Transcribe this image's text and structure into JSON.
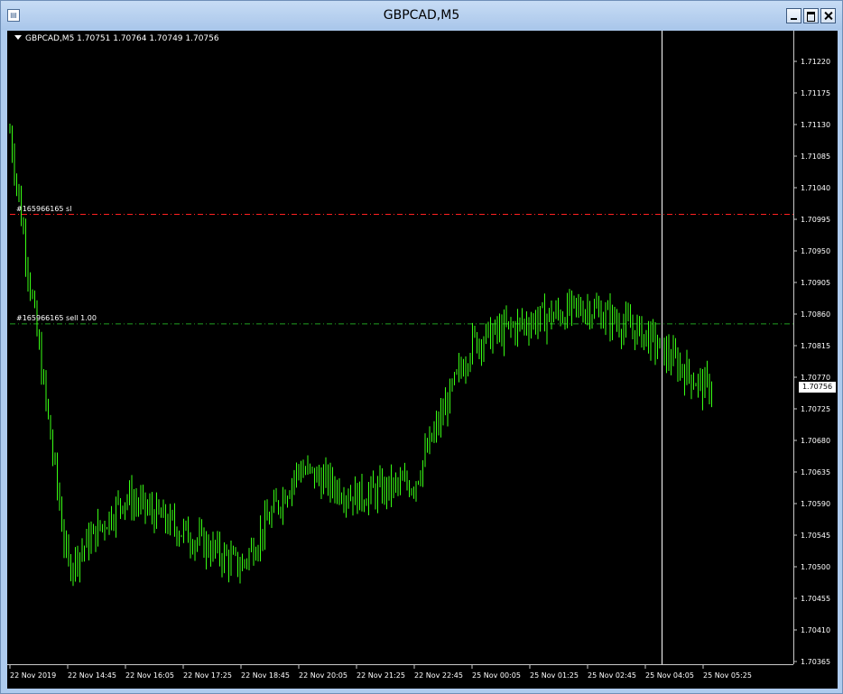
{
  "window": {
    "title": "GBPCAD,M5",
    "icon": "chart-window-icon",
    "buttons": [
      "minimize",
      "maximize",
      "close"
    ]
  },
  "colors": {
    "background": "#000000",
    "candles": "#39ff14",
    "grid_axis": "#c8c8c8",
    "sl_line": "#ff2020",
    "order_line": "#22a022",
    "crosshair": "#ffffff",
    "window_frame": "#aecbee"
  },
  "chart": {
    "symbol_info": "GBPCAD,M5  1.70751 1.70764 1.70749 1.70756",
    "current_price_label": "1.70756",
    "sl_label": "#165966165 sl",
    "order_label": "#165966165 sell 1.00",
    "price_ticks": [
      "1.71220",
      "1.71175",
      "1.71130",
      "1.71085",
      "1.71040",
      "1.70995",
      "1.70950",
      "1.70905",
      "1.70860",
      "1.70815",
      "1.70770",
      "1.70725",
      "1.70680",
      "1.70635",
      "1.70590",
      "1.70545",
      "1.70500",
      "1.70455",
      "1.70410",
      "1.70365"
    ],
    "time_ticks": [
      "22 Nov 2019",
      "22 Nov 14:45",
      "22 Nov 16:05",
      "22 Nov 17:25",
      "22 Nov 18:45",
      "22 Nov 20:05",
      "22 Nov 21:25",
      "22 Nov 22:45",
      "25 Nov 00:05",
      "25 Nov 01:25",
      "25 Nov 02:45",
      "25 Nov 04:05",
      "25 Nov 05:25"
    ]
  },
  "chart_data": {
    "type": "candlestick",
    "ylim": [
      1.7036,
      1.7126
    ],
    "price_levels": {
      "sl": 1.71002,
      "order": 1.70846,
      "current": 1.70756
    },
    "points": [
      {
        "x": "22 Nov 2019",
        "y": 1.7112
      },
      {
        "x": "22 Nov 14:45",
        "y": 1.705
      },
      {
        "x": "22 Nov 16:05",
        "y": 1.706
      },
      {
        "x": "22 Nov 17:25",
        "y": 1.7055
      },
      {
        "x": "22 Nov 18:45",
        "y": 1.705
      },
      {
        "x": "22 Nov 20:05",
        "y": 1.7064
      },
      {
        "x": "22 Nov 21:25",
        "y": 1.706
      },
      {
        "x": "22 Nov 22:45",
        "y": 1.7062
      },
      {
        "x": "25 Nov 00:05",
        "y": 1.7082
      },
      {
        "x": "25 Nov 01:25",
        "y": 1.7085
      },
      {
        "x": "25 Nov 02:45",
        "y": 1.7087
      },
      {
        "x": "25 Nov 04:05",
        "y": 1.7083
      },
      {
        "x": "25 Nov 05:25",
        "y": 1.70756
      }
    ]
  }
}
